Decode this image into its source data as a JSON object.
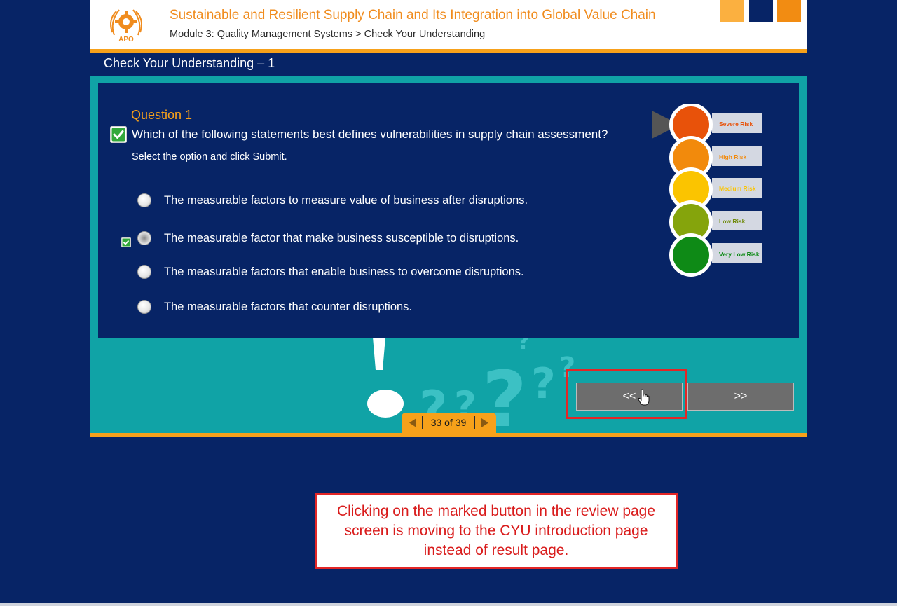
{
  "toggle": {
    "label": "»"
  },
  "header": {
    "logo_text": "APO",
    "course_title": "Sustainable and Resilient Supply Chain and Its Integration into Global Value Chain",
    "breadcrumb": "Module 3: Quality Management Systems > Check Your Understanding"
  },
  "section": {
    "title": "Check Your Understanding – 1"
  },
  "question": {
    "label": "Question 1",
    "text": "Which of the following statements best defines vulnerabilities in supply chain assessment?",
    "instruction": "Select the option and click Submit.",
    "options": [
      {
        "text": "The measurable factors to measure value of business after disruptions.",
        "selected": false,
        "correct": false
      },
      {
        "text": "The measurable factor that make business susceptible to disruptions.",
        "selected": true,
        "correct": true
      },
      {
        "text": "The measurable factors that enable business to overcome disruptions.",
        "selected": false,
        "correct": false
      },
      {
        "text": "The measurable factors that counter disruptions.",
        "selected": false,
        "correct": false
      }
    ]
  },
  "risk_levels": [
    {
      "label": "Severe Risk",
      "color": "#e8520a"
    },
    {
      "label": "High Risk",
      "color": "#f28a0c"
    },
    {
      "label": "Medium Risk",
      "color": "#fbc400"
    },
    {
      "label": "Low Risk",
      "color": "#85a40c"
    },
    {
      "label": "Very Low Risk",
      "color": "#0e8a16"
    }
  ],
  "navigation": {
    "prev_label": "<<",
    "next_label": ">>",
    "page_indicator": "33 of 39"
  },
  "annotation": {
    "note": "Clicking on the marked button in the review page screen is moving to the CYU introduction page instead of result page."
  },
  "colors": {
    "background": "#072466",
    "accent_orange": "#f7a11a",
    "title_orange": "#f08c1e",
    "teal": "#10a3a6",
    "annotation_red": "#e32626"
  }
}
